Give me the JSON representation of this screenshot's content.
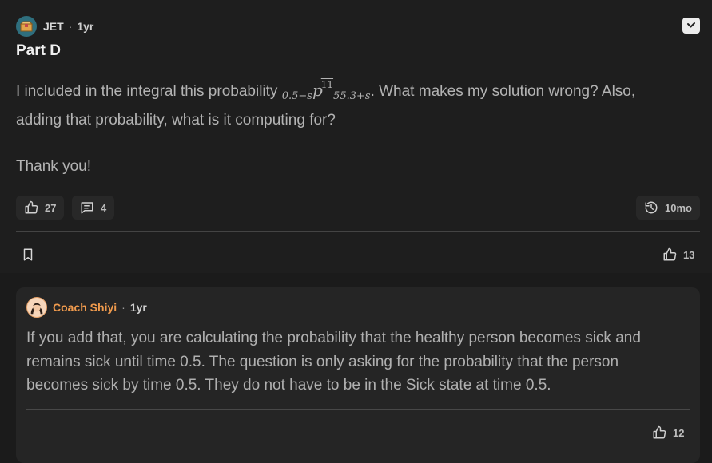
{
  "post": {
    "author": "JET",
    "age": "1yr",
    "title": "Part D",
    "text_before": "I included in the integral this probability ",
    "math": {
      "left_sub": "0.5−s",
      "symbol": "p",
      "right_sub": "55.3+s",
      "overline": "11"
    },
    "text_after": ". What makes my solution wrong? Also, adding that probability, what is it computing for?",
    "thanks": "Thank you!",
    "upvotes": "27",
    "comments": "4",
    "history_label": "10mo",
    "footer_upvotes": "13"
  },
  "reply": {
    "author": "Coach Shiyi",
    "age": "1yr",
    "text": "If you add that, you are calculating the probability that the healthy person becomes sick and remains sick until time 0.5. The question is only asking for the probability that the person becomes sick by time 0.5. They do not have to be in the Sick state at time 0.5.",
    "upvotes": "12"
  },
  "icons": [
    "avatar-box-icon",
    "thumbs-up-icon",
    "comment-icon",
    "history-icon",
    "bookmark-icon",
    "context-menu-icon"
  ],
  "colors": {
    "background": "#1b1b1b",
    "coach_name": "#ef9a4d",
    "avatar_teal": "#2f6f7e"
  }
}
